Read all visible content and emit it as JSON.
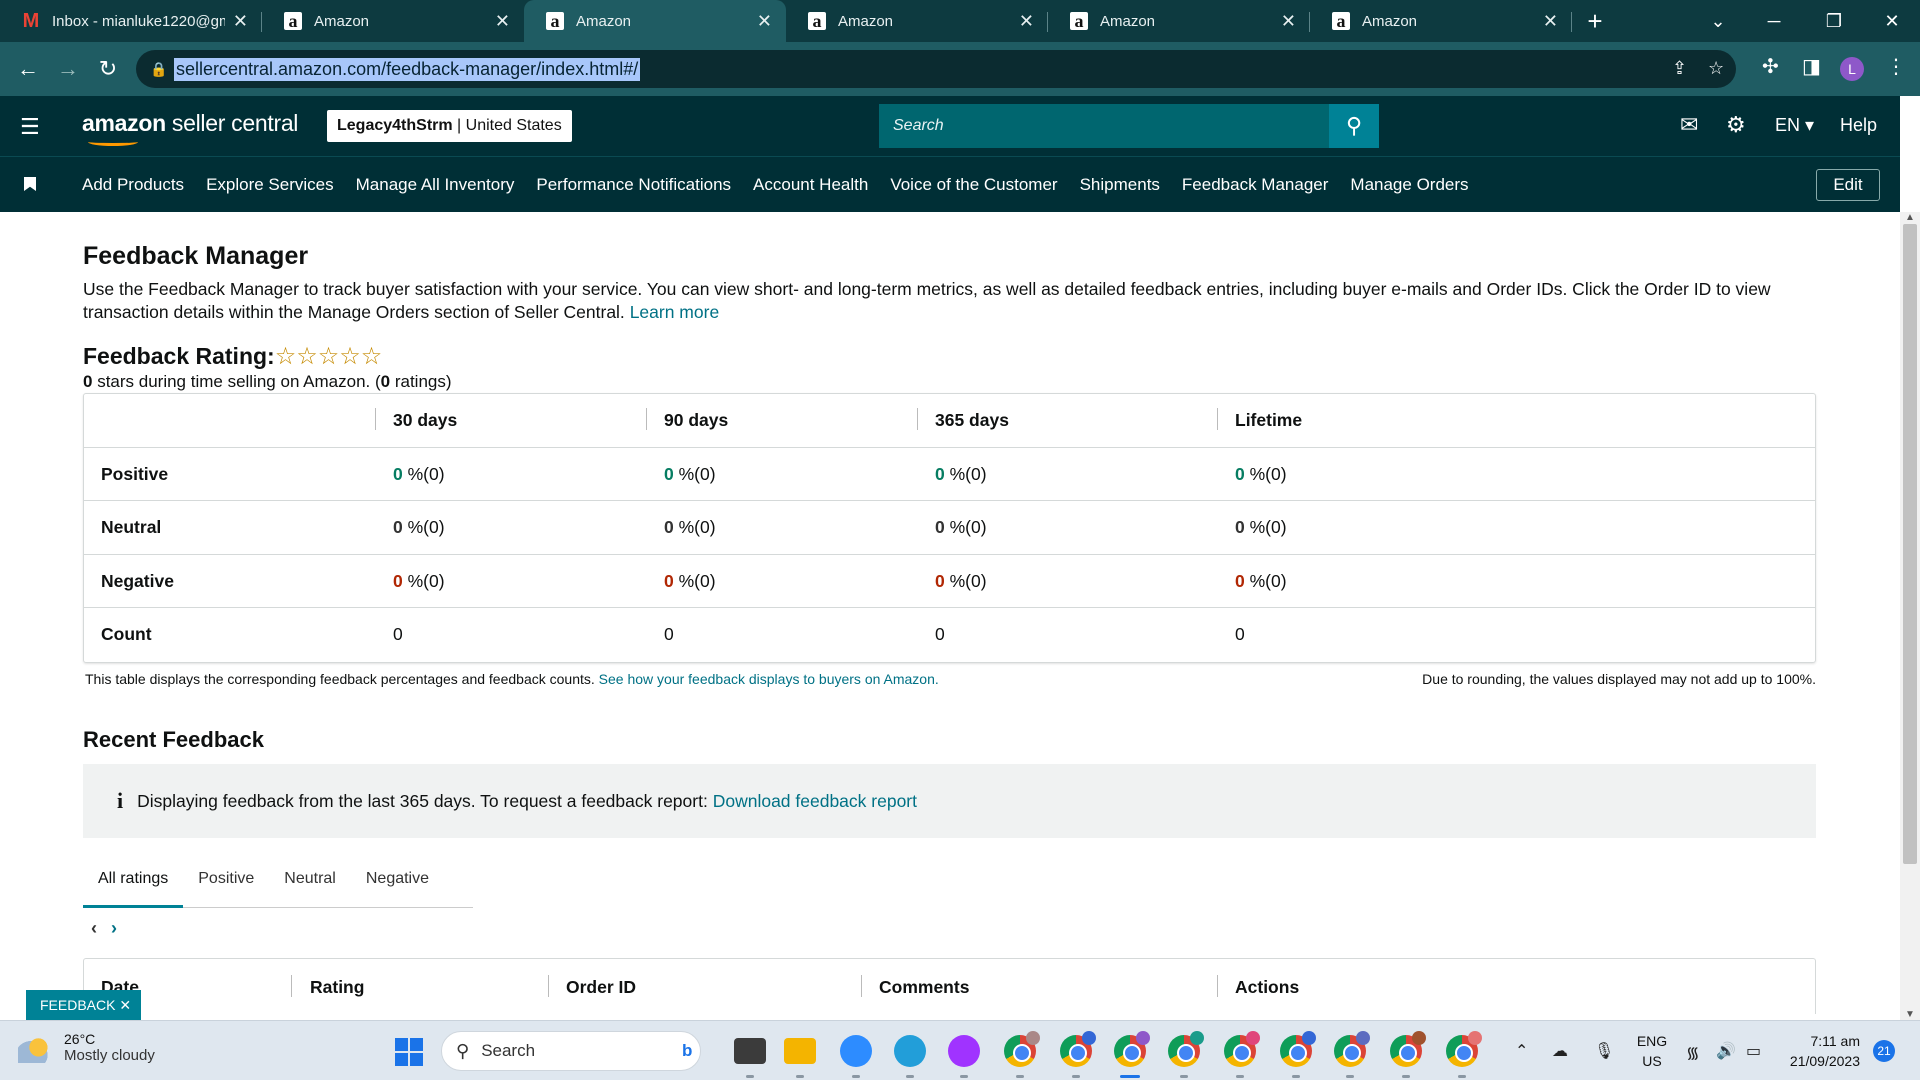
{
  "browser": {
    "tabs": [
      {
        "title": "Inbox - mianluke1220@gm",
        "favicon": "gmail-icon",
        "active": false
      },
      {
        "title": "Amazon",
        "favicon": "amazon-icon",
        "active": false
      },
      {
        "title": "Amazon",
        "favicon": "amazon-icon",
        "active": true
      },
      {
        "title": "Amazon",
        "favicon": "amazon-icon",
        "active": false
      },
      {
        "title": "Amazon",
        "favicon": "amazon-icon",
        "active": false
      },
      {
        "title": "Amazon",
        "favicon": "amazon-icon",
        "active": false
      }
    ],
    "url": "sellercentral.amazon.com/feedback-manager/index.html#/",
    "profile_initial": "L"
  },
  "header": {
    "logo_text_bold": "amazon",
    "logo_text": " seller central",
    "store_name": "Legacy4thStrm",
    "store_region": "United States",
    "search_placeholder": "Search",
    "language": "EN",
    "help": "Help"
  },
  "nav": {
    "items": [
      "Add Products",
      "Explore Services",
      "Manage All Inventory",
      "Performance Notifications",
      "Account Health",
      "Voice of the Customer",
      "Shipments",
      "Feedback Manager",
      "Manage Orders"
    ],
    "edit": "Edit"
  },
  "page": {
    "title": "Feedback Manager",
    "description": "Use the Feedback Manager to track buyer satisfaction with your service. You can view short- and long-term metrics, as well as detailed feedback entries, including buyer e-mails and Order IDs. Click the Order ID to view transaction details within the Manage Orders section of Seller Central.",
    "learn_more": "Learn more",
    "rating_label": "Feedback Rating:",
    "stars_display": "☆☆☆☆☆",
    "rating_stars": "0",
    "rating_sub_mid": " stars during time selling on Amazon. (",
    "rating_count": "0",
    "rating_sub_end": " ratings)"
  },
  "feedback_table": {
    "columns": [
      "30 days",
      "90 days",
      "365 days",
      "Lifetime"
    ],
    "rows": [
      {
        "label": "Positive",
        "values": [
          "0",
          "0",
          "0",
          "0"
        ],
        "suffix": " %(0)"
      },
      {
        "label": "Neutral",
        "values": [
          "0",
          "0",
          "0",
          "0"
        ],
        "suffix": " %(0)"
      },
      {
        "label": "Negative",
        "values": [
          "0",
          "0",
          "0",
          "0"
        ],
        "suffix": " %(0)"
      },
      {
        "label": "Count",
        "values": [
          "0",
          "0",
          "0",
          "0"
        ],
        "suffix": ""
      }
    ],
    "note_left": "This table displays the corresponding feedback percentages and feedback counts.",
    "note_left_link": "See how your feedback displays to buyers on Amazon.",
    "note_right": "Due to rounding, the values displayed may not add up to 100%."
  },
  "recent": {
    "title": "Recent Feedback",
    "info_text": "Displaying feedback from the last 365 days. To request a feedback report:",
    "info_link": "Download feedback report",
    "tabs": [
      "All ratings",
      "Positive",
      "Neutral",
      "Negative"
    ],
    "active_tab": "All ratings",
    "list_columns": [
      "Date",
      "Rating",
      "Order ID",
      "Comments",
      "Actions"
    ]
  },
  "feedback_widget": "FEEDBACK ✕",
  "taskbar": {
    "weather_temp": "26°C",
    "weather_desc": "Mostly cloudy",
    "search": "Search",
    "lang_line1": "ENG",
    "lang_line2": "US",
    "time": "7:11 am",
    "date": "21/09/2023",
    "notifications": "21"
  }
}
